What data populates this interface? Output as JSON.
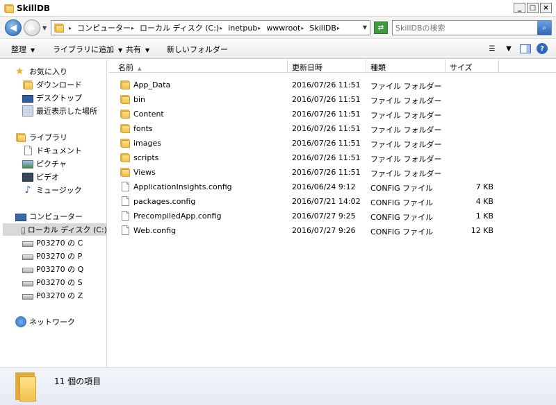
{
  "window": {
    "title": "SkillDB",
    "buttons": {
      "minimize": "_",
      "maximize": "□",
      "close": "×"
    }
  },
  "address": {
    "breadcrumbs": [
      "コンピューター",
      "ローカル ディスク (C:)",
      "inetpub",
      "wwwroot",
      "SkillDB"
    ],
    "search_placeholder": "SkillDBの検索"
  },
  "toolbar": {
    "organize": "整理",
    "add_to_library": "ライブラリに追加",
    "share": "共有",
    "new_folder": "新しいフォルダー"
  },
  "nav": {
    "favorites_header": "お気に入り",
    "favorites": [
      "ダウンロード",
      "デスクトップ",
      "最近表示した場所"
    ],
    "libraries_header": "ライブラリ",
    "libraries": [
      "ドキュメント",
      "ピクチャ",
      "ビデオ",
      "ミュージック"
    ],
    "computer_header": "コンピューター",
    "computer": [
      "ローカル ディスク (C:)",
      "P03270 の C",
      "P03270 の P",
      "P03270 の Q",
      "P03270 の S",
      "P03270 の Z"
    ],
    "network_header": "ネットワーク",
    "selected": "ローカル ディスク (C:)"
  },
  "columns": {
    "name": "名前",
    "date": "更新日時",
    "type": "種類",
    "size": "サイズ"
  },
  "files": [
    {
      "name": "App_Data",
      "date": "2016/07/26 11:51",
      "type": "ファイル フォルダー",
      "size": "",
      "kind": "folder"
    },
    {
      "name": "bin",
      "date": "2016/07/26 11:51",
      "type": "ファイル フォルダー",
      "size": "",
      "kind": "folder"
    },
    {
      "name": "Content",
      "date": "2016/07/26 11:51",
      "type": "ファイル フォルダー",
      "size": "",
      "kind": "folder"
    },
    {
      "name": "fonts",
      "date": "2016/07/26 11:51",
      "type": "ファイル フォルダー",
      "size": "",
      "kind": "folder"
    },
    {
      "name": "images",
      "date": "2016/07/26 11:51",
      "type": "ファイル フォルダー",
      "size": "",
      "kind": "folder"
    },
    {
      "name": "scripts",
      "date": "2016/07/26 11:51",
      "type": "ファイル フォルダー",
      "size": "",
      "kind": "folder"
    },
    {
      "name": "Views",
      "date": "2016/07/26 11:51",
      "type": "ファイル フォルダー",
      "size": "",
      "kind": "folder"
    },
    {
      "name": "ApplicationInsights.config",
      "date": "2016/06/24 9:12",
      "type": "CONFIG ファイル",
      "size": "7 KB",
      "kind": "file"
    },
    {
      "name": "packages.config",
      "date": "2016/07/21 14:02",
      "type": "CONFIG ファイル",
      "size": "4 KB",
      "kind": "file"
    },
    {
      "name": "PrecompiledApp.config",
      "date": "2016/07/27 9:25",
      "type": "CONFIG ファイル",
      "size": "1 KB",
      "kind": "file"
    },
    {
      "name": "Web.config",
      "date": "2016/07/27 9:26",
      "type": "CONFIG ファイル",
      "size": "12 KB",
      "kind": "file"
    }
  ],
  "status": {
    "item_count": "11 個の項目"
  },
  "colors": {
    "selection": "#d9d9d9",
    "folder": "#f0c04c",
    "accent": "#2d67b9"
  }
}
